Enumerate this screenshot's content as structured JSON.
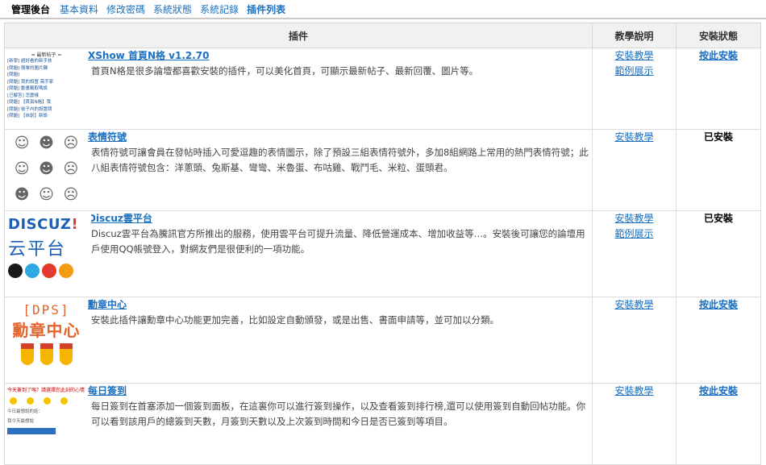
{
  "topnav": {
    "brand": "管理後台",
    "items": [
      "基本資料",
      "修改密碼",
      "系統狀態",
      "系統記錄",
      "插件列表"
    ]
  },
  "table": {
    "headers": [
      "插件",
      "教學說明",
      "安裝狀態"
    ]
  },
  "plugins": [
    {
      "name": "XShow 首頁N格 v1.2.70",
      "desc": "首頁N格是很多論壇都喜歡安裝的插件，可以美化首頁，可顯示最新帖子、最新回覆、圖片等。",
      "links": [
        "安裝教學",
        "範例展示"
      ],
      "status": "按此安裝",
      "installed": false,
      "thumb": {
        "header": "= 最新帖子 =",
        "rows": [
          "[新學] 超好看的新手技",
          "[問題] 簡單的圖片轉",
          "[問題]",
          "[問題] 我的設置 需手家",
          "[問題] 動畫截取嗎設",
          "[已解答] 怎麼樣",
          "[問題] 【首頁N格】我",
          "[問題] 帖子內的設置問",
          "[問題] 【自創】新設"
        ]
      }
    },
    {
      "name": "表情符號",
      "desc": "表情符號可讓會員在發帖時插入可愛逗趣的表情圖示，除了預設三組表情符號外，多加8組網路上常用的熱門表情符號；此八組表情符號包含：洋蔥頭、兔斯基、彎彎、米魯蛋、布咕雞、戰鬥毛、米粒、蛋頭君。",
      "links": [
        "安裝教學"
      ],
      "status": "已安裝",
      "installed": true,
      "thumb": {
        "emotes": [
          "ಠ‿ಠ",
          "ʘ‿ʘ",
          "ᕕ( ᐛ )ᕗ",
          "◔_◔",
          "ಥ_ಥ",
          "ᗒᗣᗕ",
          "♨_♨",
          "ツ",
          "⊙﹏⊙"
        ]
      }
    },
    {
      "name": "Discuz雲平台",
      "desc": "Discuz雲平台為騰訊官方所推出的服務，使用雲平台可提升流量、降低營運成本、增加收益等…。安裝後可讓您的論壇用戶使用QQ帳號登入，對網友們是很便利的一項功能。",
      "links": [
        "安裝教學",
        "範例展示"
      ],
      "status": "已安裝",
      "installed": true,
      "thumb": {
        "logo_main": "DISCUZ",
        "logo_bang": "!",
        "cloud": "云平台"
      }
    },
    {
      "name": "勳章中心",
      "desc": "安裝此插件讓勳章中心功能更加完善，比如設定自動頒發，或是出售、書面申請等，並可加以分類。",
      "links": [
        "安裝教學"
      ],
      "status": "按此安裝",
      "installed": false,
      "thumb": {
        "line1": "[DPS]",
        "line2": "勳章中心"
      }
    },
    {
      "name": "每日簽到",
      "desc": "每日簽到在首塞添加一個簽到面板，在這裏你可以進行簽到操作，以及查看簽到排行榜,還可以使用簽到自動回帖功能。你可以看到該用戶的總簽到天數，月簽到天數以及上次簽到時間和今日是否已簽到等項目。",
      "links": [
        "安裝教學"
      ],
      "status": "按此安裝",
      "installed": false,
      "thumb": {
        "top": "今天簽到了嗎？請選擇您此刻的心情",
        "line1": "今日最想說的話：",
        "line2": "我今天最想說"
      }
    }
  ],
  "colors": {
    "link": "#1a6fbf",
    "header_bg": "#f1f1f1"
  }
}
